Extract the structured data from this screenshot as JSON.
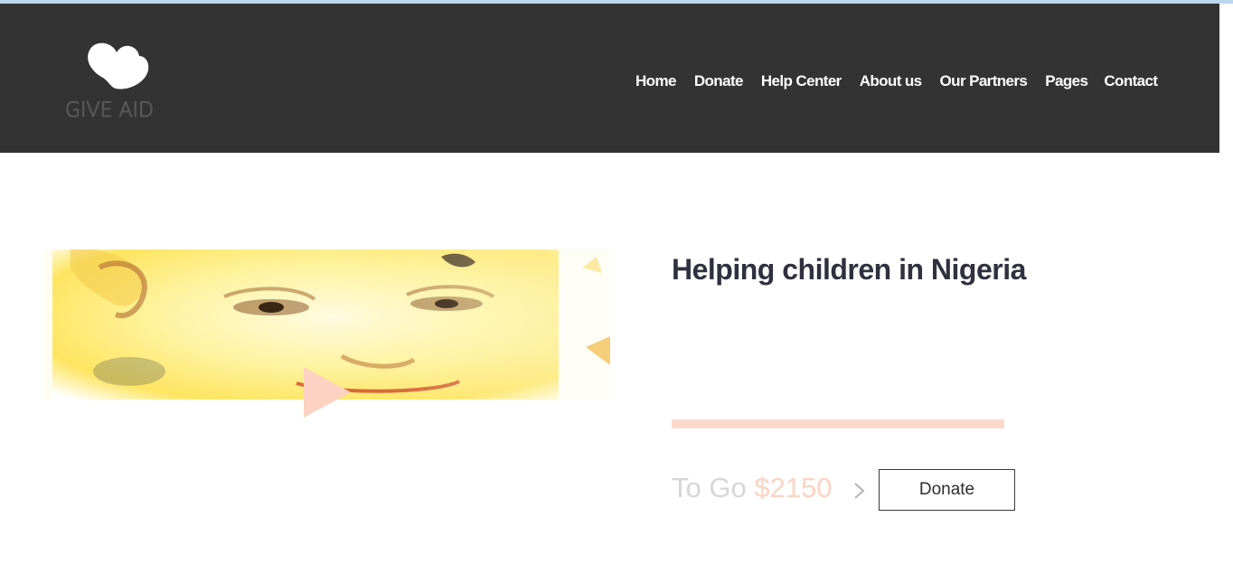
{
  "header": {
    "logo_text": "GIVE AID",
    "nav": [
      {
        "label": "Home"
      },
      {
        "label": "Donate"
      },
      {
        "label": "Help Center"
      },
      {
        "label": "About us"
      },
      {
        "label": "Our Partners"
      },
      {
        "label": "Pages"
      },
      {
        "label": "Contact"
      }
    ]
  },
  "campaign": {
    "title": "Helping children in Nigeria",
    "to_go_label": "To Go",
    "to_go_amount": "$2150",
    "donate_label": "Donate",
    "progress": 1.0
  },
  "icons": {
    "logo": "heart-logo-icon",
    "play": "play-icon",
    "chevron": "chevron-right-icon"
  },
  "colors": {
    "header_bg": "#333333",
    "accent": "#fcd3c3",
    "title": "#30303f"
  }
}
